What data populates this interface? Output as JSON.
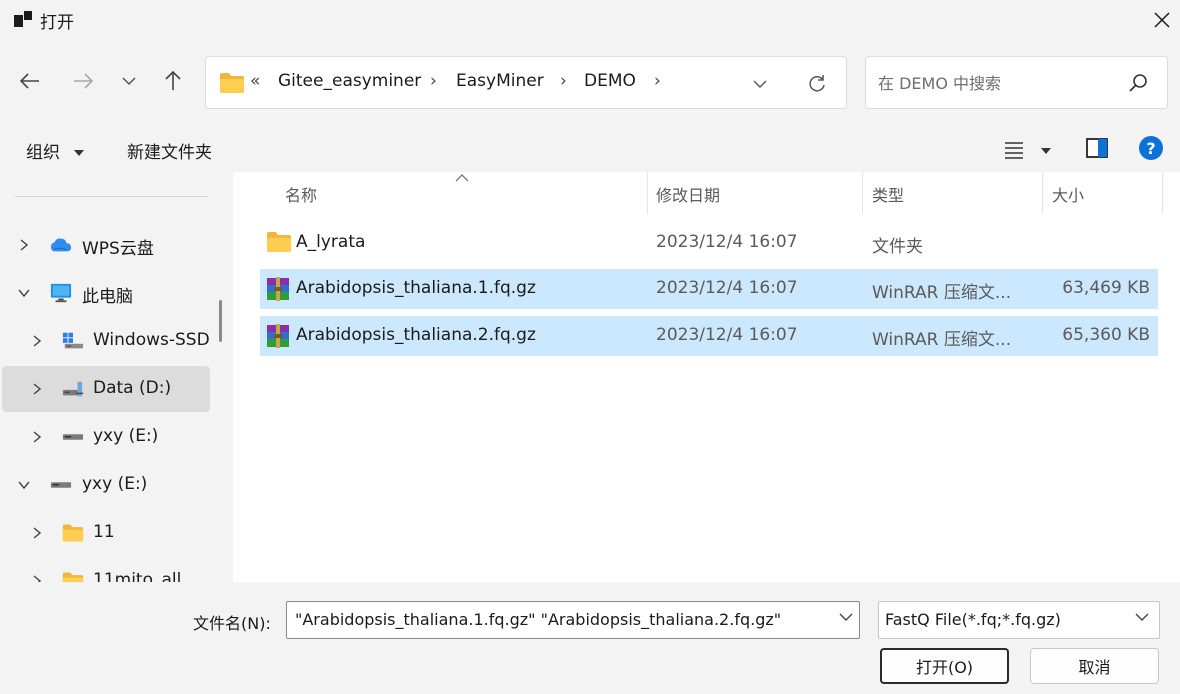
{
  "window": {
    "title": "打开"
  },
  "address": {
    "overflow": "«",
    "crumbs": [
      "Gitee_easyminer",
      "EasyMiner",
      "DEMO"
    ]
  },
  "search": {
    "placeholder": "在 DEMO 中搜索"
  },
  "toolbar": {
    "organize": "组织",
    "new_folder": "新建文件夹"
  },
  "sidebar": {
    "items": [
      {
        "label": "WPS云盘",
        "icon": "cloud-icon"
      },
      {
        "label": "此电脑",
        "icon": "computer-icon"
      },
      {
        "label": "Windows-SSD",
        "icon": "windows-drive-icon"
      },
      {
        "label": "Data (D:)",
        "icon": "network-drive-icon"
      },
      {
        "label": "yxy (E:)",
        "icon": "drive-icon"
      },
      {
        "label": "yxy (E:)",
        "icon": "drive-icon"
      },
      {
        "label": "11",
        "icon": "folder-icon"
      },
      {
        "label": "11mito_all",
        "icon": "folder-icon"
      }
    ]
  },
  "columns": {
    "name": "名称",
    "modified": "修改日期",
    "type": "类型",
    "size": "大小"
  },
  "files": [
    {
      "name": "A_lyrata",
      "modified": "2023/12/4 16:07",
      "type": "文件夹",
      "size": "",
      "icon": "folder-icon",
      "selected": false
    },
    {
      "name": "Arabidopsis_thaliana.1.fq.gz",
      "modified": "2023/12/4 16:07",
      "type": "WinRAR 压缩文...",
      "size": "63,469 KB",
      "icon": "winrar-archive-icon",
      "selected": true
    },
    {
      "name": "Arabidopsis_thaliana.2.fq.gz",
      "modified": "2023/12/4 16:07",
      "type": "WinRAR 压缩文...",
      "size": "65,360 KB",
      "icon": "winrar-archive-icon",
      "selected": true
    }
  ],
  "footer": {
    "filename_label": "文件名(N):",
    "filename_value": "\"Arabidopsis_thaliana.1.fq.gz\" \"Arabidopsis_thaliana.2.fq.gz\"",
    "filter": "FastQ File(*.fq;*.fq.gz)",
    "open_button": "打开(O)",
    "cancel_button": "取消"
  },
  "colors": {
    "selection": "#cce8ff",
    "folder": "#f0b73c",
    "help": "#0b73d8"
  }
}
